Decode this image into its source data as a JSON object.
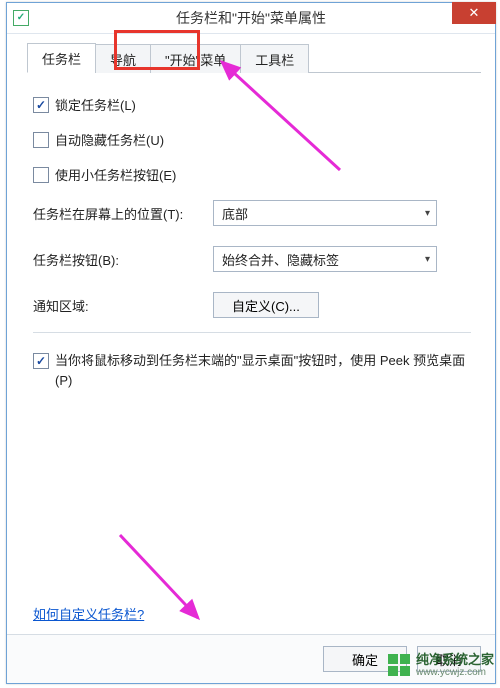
{
  "window": {
    "title": "任务栏和\"开始\"菜单属性"
  },
  "tabs": {
    "items": [
      {
        "label": "任务栏"
      },
      {
        "label": "导航"
      },
      {
        "label": "\"开始\"菜单"
      },
      {
        "label": "工具栏"
      }
    ]
  },
  "taskbarPanel": {
    "lockTaskbar": "锁定任务栏(L)",
    "autoHide": "自动隐藏任务栏(U)",
    "smallButtons": "使用小任务栏按钮(E)",
    "positionLabel": "任务栏在屏幕上的位置(T):",
    "positionValue": "底部",
    "buttonsLabel": "任务栏按钮(B):",
    "buttonsValue": "始终合并、隐藏标签",
    "notificationLabel": "通知区域:",
    "customizeButton": "自定义(C)...",
    "peekDesktop": "当你将鼠标移动到任务栏末端的\"显示桌面\"按钮时，使用 Peek 预览桌面(P)"
  },
  "helpLink": "如何自定义任务栏?",
  "footer": {
    "ok": "确定",
    "cancel": "取消"
  },
  "watermark": {
    "name": "纯净系统之家",
    "url": "www.ycwjz.com"
  }
}
